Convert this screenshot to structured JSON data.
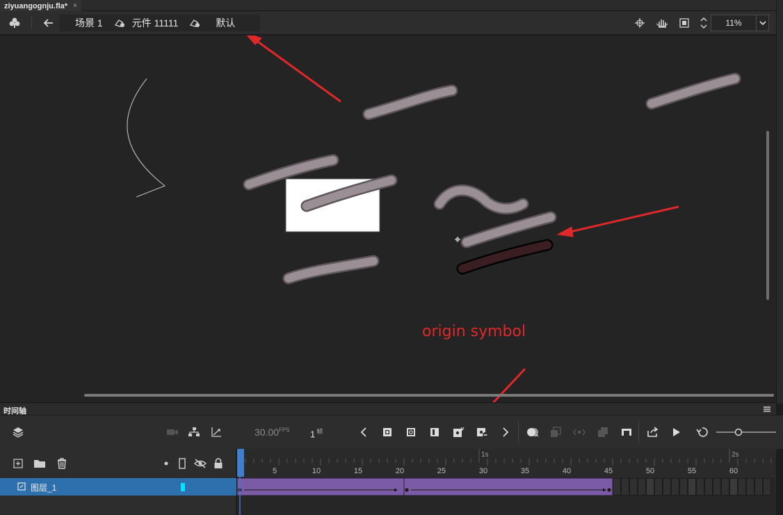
{
  "document": {
    "tab_title": "ziyuangognju.fla*",
    "close_glyph": "×"
  },
  "edit_bar": {
    "breadcrumb": [
      {
        "label": "场景 1"
      },
      {
        "label": "元件 11111"
      },
      {
        "label": "默认"
      }
    ],
    "zoom": "11%"
  },
  "stage": {
    "annotation": "origin symbol",
    "colors": {
      "background": "#242424",
      "stroke": "#948a8f",
      "selected": "#3a1e22",
      "annotation": "#e0282a"
    }
  },
  "timeline": {
    "title": "时间轴",
    "fps_value": "30.00",
    "fps_unit": "FPS",
    "current_frame": "1",
    "frame_unit": "帧",
    "ruler": {
      "time_marks": [
        "1s",
        "2s"
      ],
      "frame_labels": [
        "5",
        "10",
        "15",
        "20",
        "25",
        "30",
        "35",
        "40",
        "45",
        "50",
        "55",
        "60"
      ]
    },
    "layers": [
      {
        "name": "图层_1",
        "color": "#00e5ff"
      }
    ],
    "tween_color": "#7b5aa6"
  }
}
